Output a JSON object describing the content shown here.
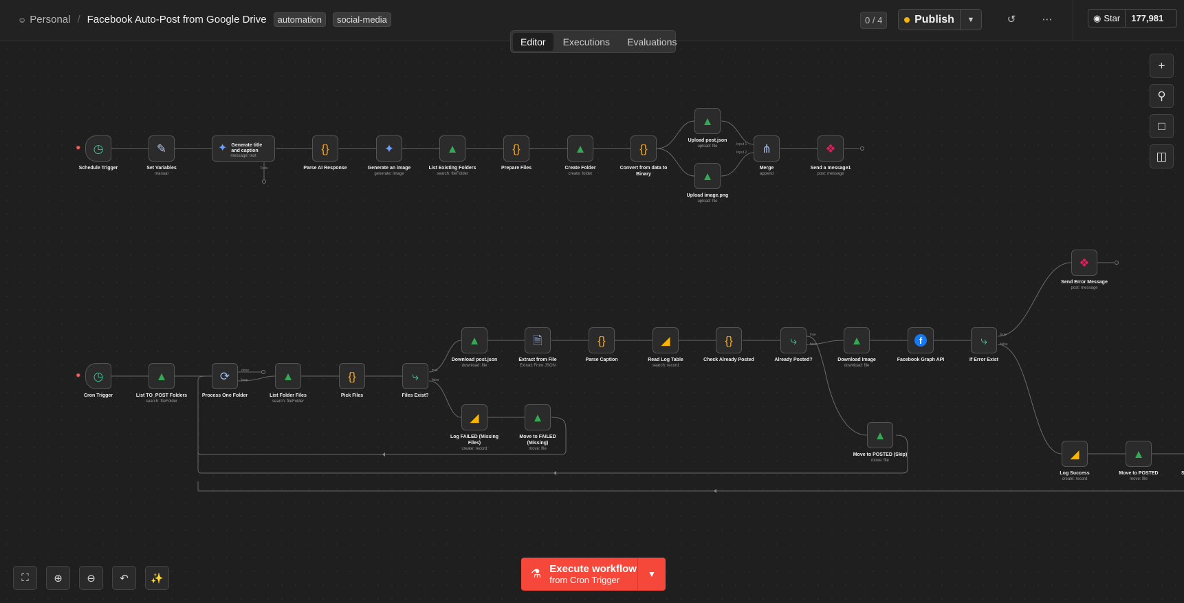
{
  "header": {
    "workspace": "Personal",
    "separator": "/",
    "workflow_title": "Facebook Auto-Post from Google Drive",
    "tags": [
      "automation",
      "social-media"
    ],
    "counter": "0 / 4",
    "publish_label": "Publish",
    "github_star_label": "Star",
    "github_star_count": "177,981"
  },
  "tabs": [
    "Editor",
    "Executions",
    "Evaluations"
  ],
  "nodes": {
    "schedule_trigger": {
      "label": "Schedule Trigger",
      "sub": ""
    },
    "set_variables": {
      "label": "Set Variables",
      "sub": "manual"
    },
    "generate_title": {
      "label": "Generate title and caption",
      "sub": "message: text",
      "port": "Tools"
    },
    "parse_ai": {
      "label": "Parse AI Response",
      "sub": ""
    },
    "generate_image": {
      "label": "Generate an image",
      "sub": "generate: image"
    },
    "list_existing": {
      "label": "List Existing Folders",
      "sub": "search: fileFolder"
    },
    "prepare_files": {
      "label": "Prepare Files",
      "sub": ""
    },
    "create_folder": {
      "label": "Create Folder",
      "sub": "create: folder"
    },
    "convert_binary": {
      "label": "Convert from data to Binary",
      "sub": ""
    },
    "upload_post": {
      "label": "Upload post.json",
      "sub": "upload: file"
    },
    "upload_image": {
      "label": "Upload image.png",
      "sub": "upload: file"
    },
    "merge": {
      "label": "Merge",
      "sub": "append",
      "in1": "Input 1",
      "in2": "Input 2"
    },
    "send_message1": {
      "label": "Send a message1",
      "sub": "post: message"
    },
    "cron_trigger": {
      "label": "Cron Trigger",
      "sub": ""
    },
    "list_to_post": {
      "label": "List TO_POST Folders",
      "sub": "search: fileFolder"
    },
    "process_one": {
      "label": "Process One Folder",
      "sub": "",
      "done": "done",
      "loop": "loop"
    },
    "list_folder_files": {
      "label": "List Folder Files",
      "sub": "search: fileFolder"
    },
    "pick_files": {
      "label": "Pick Files",
      "sub": ""
    },
    "files_exist": {
      "label": "Files Exist?",
      "sub": "",
      "t": "true",
      "f": "false"
    },
    "download_post": {
      "label": "Download post.json",
      "sub": "download: file"
    },
    "extract_file": {
      "label": "Extract from File",
      "sub": "Extract From JSON"
    },
    "parse_caption": {
      "label": "Parse Caption",
      "sub": ""
    },
    "read_log": {
      "label": "Read Log Table",
      "sub": "search: record"
    },
    "check_posted": {
      "label": "Check Already Posted",
      "sub": ""
    },
    "already_posted": {
      "label": "Already Posted?",
      "sub": "",
      "t": "true",
      "f": "false"
    },
    "download_image": {
      "label": "Download Image",
      "sub": "download: file"
    },
    "fb_graph": {
      "label": "Facebook Graph API",
      "sub": ""
    },
    "if_error": {
      "label": "If Error Exist",
      "sub": "",
      "t": "true",
      "f": "false"
    },
    "send_error": {
      "label": "Send Error Message",
      "sub": "post: message"
    },
    "log_failed": {
      "label": "Log FAILED (Missing Files)",
      "sub": "create: record"
    },
    "move_failed": {
      "label": "Move to FAILED (Missing)",
      "sub": "move: file"
    },
    "move_skip": {
      "label": "Move to POSTED (Skip)",
      "sub": "move: file"
    },
    "log_success": {
      "label": "Log Success",
      "sub": "create: record"
    },
    "move_posted": {
      "label": "Move to POSTED",
      "sub": "move: file"
    },
    "send_cut": {
      "label": "Se",
      "sub": ""
    }
  },
  "execute": {
    "line1": "Execute workflow",
    "line2": "from Cron Trigger"
  },
  "icons": {
    "schedule": "clock-icon",
    "set": "pencil-icon",
    "gemini": "gemini-icon",
    "code": "code-braces-icon",
    "drive": "google-drive-icon",
    "merge": "merge-icon",
    "slack": "slack-icon",
    "loop": "loop-icon",
    "if": "if-branch-icon",
    "extract": "extract-file-icon",
    "airtable": "airtable-icon",
    "facebook": "facebook-icon"
  },
  "colors": {
    "accent": "#f5483b",
    "publish_dot": "#f5b400",
    "trigger_bolt": "#ff5b5b"
  }
}
